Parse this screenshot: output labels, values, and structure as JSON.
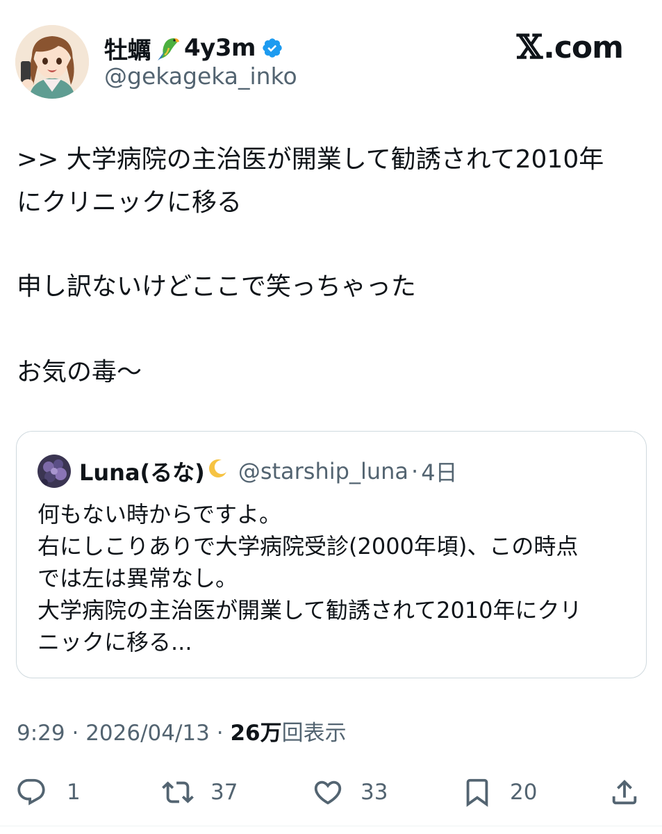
{
  "author": {
    "display_name": "牡蠣",
    "display_suffix": "4y3m",
    "handle": "@gekageka_inko",
    "verified": true,
    "avatar_icon": "anime-avatar"
  },
  "site": {
    "logo_text": ".com",
    "logo_mark": "𝕏"
  },
  "tweet": {
    "lines": [
      ">> 大学病院の主治医が開業して勧誘されて2010年",
      "にクリニックに移る",
      "申し訳ないけどここで笑っちゃった",
      "お気の毒〜"
    ]
  },
  "quote": {
    "display_name": "Luna(るな)",
    "handle": "@starship_luna",
    "separator": "·",
    "time": "4日",
    "lines": [
      "何もない時からですよ。",
      "右にしこりありで大学病院受診(2000年頃)、この時点",
      "では左は異常なし。",
      "大学病院の主治医が開業して勧誘されて2010年にクリ",
      "ニックに移る..."
    ]
  },
  "meta": {
    "time": "9:29",
    "date": "2026/04/13",
    "sep": " · ",
    "views": "26万",
    "views_label": "回表示"
  },
  "actions": {
    "replies": "1",
    "retweets": "37",
    "likes": "33",
    "bookmarks": "20"
  },
  "colors": {
    "text": "#0f1419",
    "secondary": "#536471",
    "verified": "#1d9bf0",
    "border": "#cfd9de"
  }
}
